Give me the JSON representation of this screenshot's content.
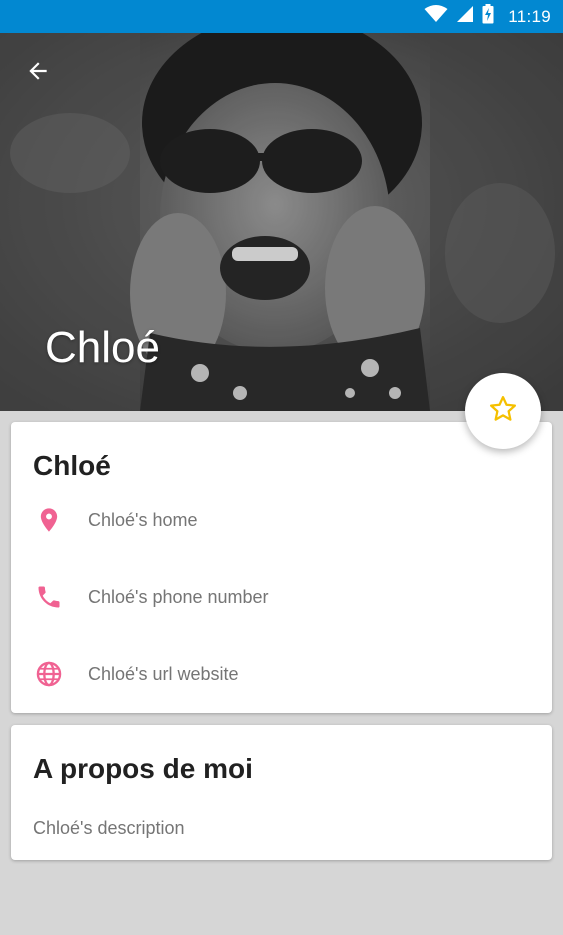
{
  "status_bar": {
    "time": "11:19",
    "icons": [
      "wifi-icon",
      "cell-signal-icon",
      "battery-charging-icon"
    ]
  },
  "header": {
    "title": "Chloé",
    "back_icon": "arrow-back-icon",
    "background_color": "#0288d1"
  },
  "fab": {
    "icon": "star-outline-icon",
    "color": "#f5c000"
  },
  "info_card": {
    "name": "Chloé",
    "rows": [
      {
        "icon": "location-pin-icon",
        "label": "Chloé's home"
      },
      {
        "icon": "phone-icon",
        "label": "Chloé's phone number"
      },
      {
        "icon": "globe-icon",
        "label": "Chloé's url website"
      }
    ],
    "icon_color": "#f06292"
  },
  "about_card": {
    "title": "A propos de moi",
    "description": "Chloé's description"
  }
}
